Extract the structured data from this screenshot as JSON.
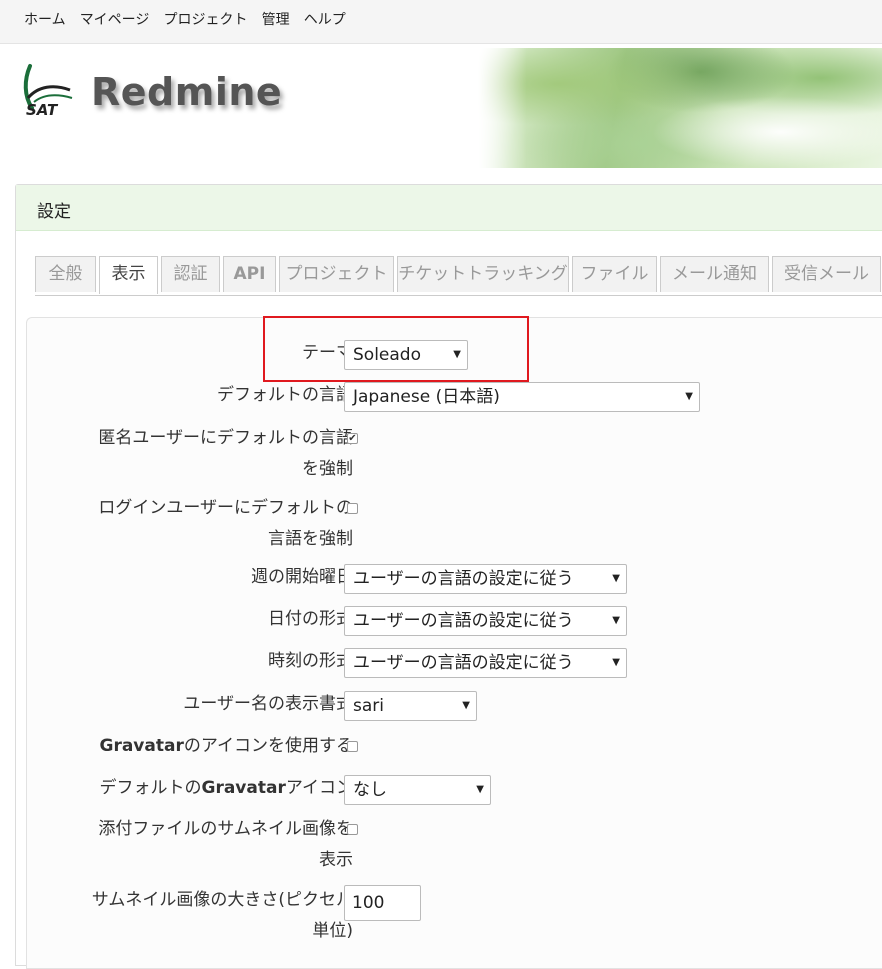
{
  "top_menu": [
    "ホーム",
    "マイページ",
    "プロジェクト",
    "管理",
    "ヘルプ"
  ],
  "header": {
    "logo_text": "SAT",
    "site_title": "Redmine"
  },
  "page_title": "設定",
  "tabs": [
    {
      "label": "全般",
      "selected": false
    },
    {
      "label": "表示",
      "selected": true
    },
    {
      "label": "認証",
      "selected": false
    },
    {
      "label": "API",
      "selected": false
    },
    {
      "label": "プロジェクト",
      "selected": false
    },
    {
      "label": "チケットトラッキング",
      "selected": false
    },
    {
      "label": "ファイル",
      "selected": false
    },
    {
      "label": "メール通知",
      "selected": false
    },
    {
      "label": "受信メール",
      "selected": false
    }
  ],
  "settings": {
    "theme": {
      "label": "テーマ",
      "value": "Soleado"
    },
    "default_language": {
      "label": "デフォルトの言語",
      "value": "Japanese (日本語)"
    },
    "force_default_language_anonymous": {
      "label_line1": "匿名ユーザーにデフォルトの言語",
      "label_line2": "を強制",
      "checked": true
    },
    "force_default_language_loggedin": {
      "label_line1": "ログインユーザーにデフォルトの",
      "label_line2": "言語を強制",
      "checked": false
    },
    "start_of_week": {
      "label": "週の開始曜日",
      "value": "ユーザーの言語の設定に従う"
    },
    "date_format": {
      "label": "日付の形式",
      "value": "ユーザーの言語の設定に従う"
    },
    "time_format": {
      "label": "時刻の形式",
      "value": "ユーザーの言語の設定に従う"
    },
    "user_format": {
      "label": "ユーザー名の表示書式",
      "value": "sari"
    },
    "gravatar_enabled": {
      "label_bold": "Gravatar",
      "label_rest": "のアイコンを使用する",
      "checked": false
    },
    "gravatar_default": {
      "label_pre": "デフォルトの",
      "label_bold": "Gravatar",
      "label_post": "アイコン",
      "value": "なし"
    },
    "thumbnails_enabled": {
      "label_line1": "添付ファイルのサムネイル画像を",
      "label_line2": "表示",
      "checked": false
    },
    "thumbnails_size": {
      "label_line1": "サムネイル画像の大きさ(ピクセル",
      "label_line2": "単位)",
      "value": "100"
    }
  },
  "check_mark": "✔",
  "dropdown_arrow": "▼",
  "colors": {
    "highlight": "#e0191f",
    "page_header_bg": "#ecf7e8"
  }
}
